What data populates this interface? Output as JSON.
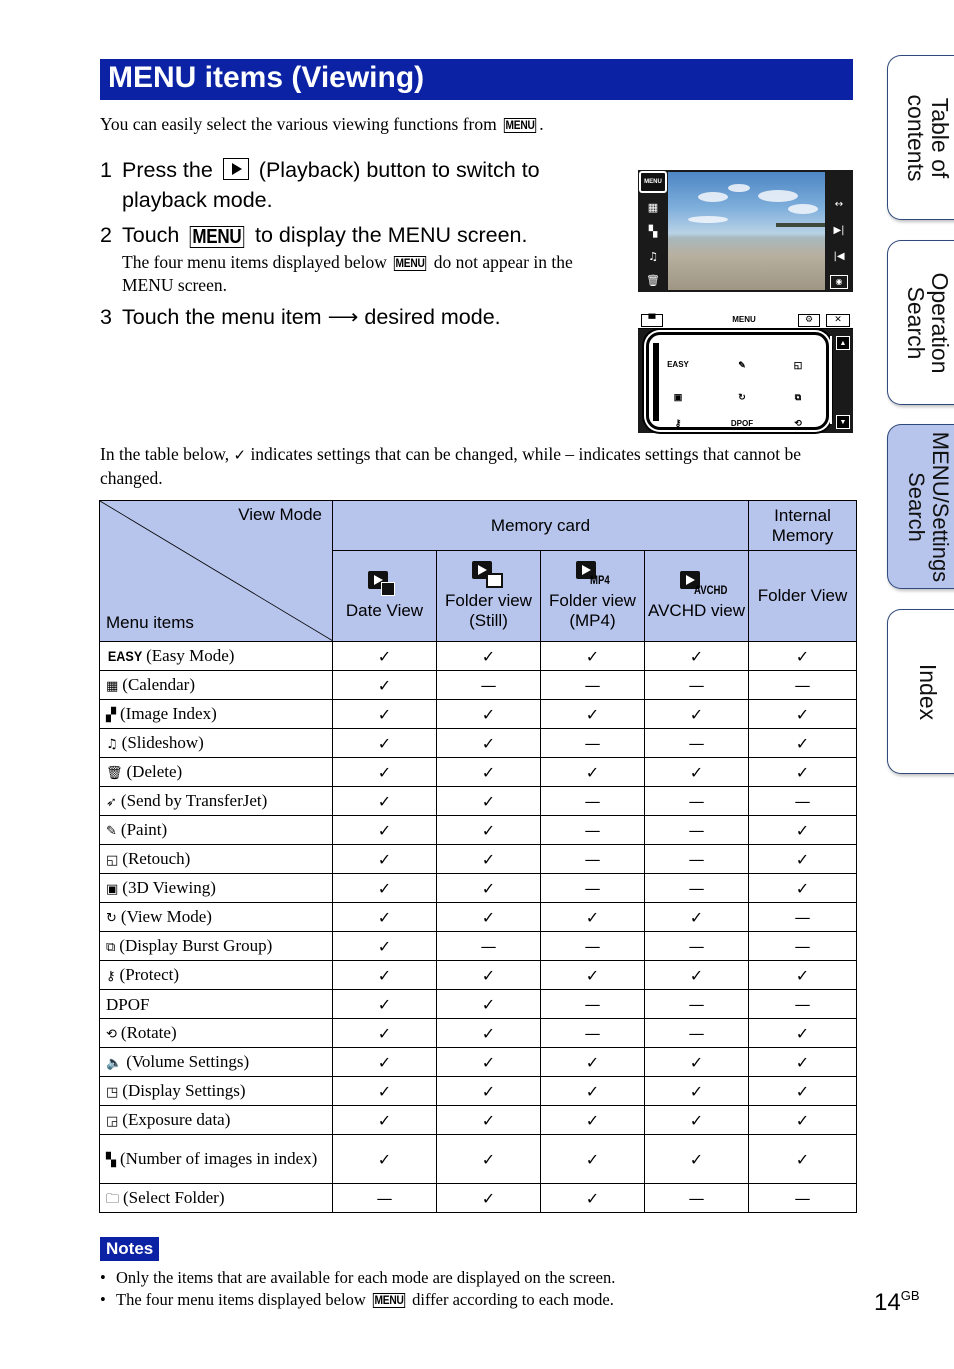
{
  "header": {
    "title": "MENU items (Viewing)"
  },
  "intro": {
    "text": "You can easily select the various viewing functions from",
    "menu_glyph": "MENU",
    "end": "."
  },
  "steps": [
    {
      "num": "1",
      "pre": "Press the",
      "icon": "playback-icon",
      "post": "(Playback) button to switch to playback mode."
    },
    {
      "num": "2",
      "pre": "Touch",
      "glyph": "MENU",
      "post": "to display the MENU screen.",
      "note_pre": "The four menu items displayed below",
      "note_glyph": "MENU",
      "note_post": "do not appear in the MENU screen."
    },
    {
      "num": "3",
      "pre": "Touch the menu item",
      "arrow": "⟶",
      "post": "desired mode."
    }
  ],
  "camera_screen_1": {
    "menu_button": "MENU",
    "left_icons": [
      "calendar-icon",
      "image-index-icon",
      "slideshow-icon",
      "delete-icon"
    ],
    "right_icons": [
      "zoom-arrows-icon",
      "next-icon",
      "previous-icon",
      "camera-icon"
    ]
  },
  "camera_screen_2": {
    "title": "MENU",
    "top_buttons": {
      "left": "toolbox-icon",
      "settings": "gear-icon",
      "close": "✕"
    },
    "items": [
      "EASY",
      "paint-icon",
      "retouch-icon",
      "3d-viewing-icon",
      "view-mode-icon",
      "burst-group-icon",
      "protect-icon",
      "DPOF",
      "rotate-icon"
    ],
    "scroll_up": "▲",
    "scroll_down": "▼"
  },
  "legend": {
    "pre": "In the table below,",
    "check": "✓",
    "post": "indicates settings that can be changed, while – indicates settings that cannot be changed."
  },
  "table": {
    "corner_top": "View Mode",
    "corner_bottom": "Menu items",
    "group_memory_card": "Memory card",
    "group_internal": "Internal Memory",
    "columns": [
      {
        "label": "Date View",
        "icon": "date-view-icon"
      },
      {
        "label": "Folder view (Still)",
        "icon": "folder-view-still-icon"
      },
      {
        "label": "Folder view (MP4)",
        "icon": "folder-view-mp4-icon",
        "sub": "MP4"
      },
      {
        "label": "AVCHD view",
        "icon": "avchd-view-icon",
        "sub": "AVCHD"
      },
      {
        "label": "Folder View",
        "icon": ""
      }
    ],
    "check_symbol": "✓",
    "dash_symbol": "—",
    "rows": [
      {
        "icon": "EASY",
        "label": "(Easy Mode)",
        "values": [
          true,
          true,
          true,
          true,
          true
        ]
      },
      {
        "icon": "▦",
        "label": "(Calendar)",
        "values": [
          true,
          false,
          false,
          false,
          false
        ]
      },
      {
        "icon": "▞",
        "label": "(Image Index)",
        "values": [
          true,
          true,
          true,
          true,
          true
        ]
      },
      {
        "icon": "♫",
        "label": "(Slideshow)",
        "values": [
          true,
          true,
          false,
          false,
          true
        ]
      },
      {
        "icon": "🗑",
        "label": "(Delete)",
        "values": [
          true,
          true,
          true,
          true,
          true
        ]
      },
      {
        "icon": "➶",
        "label": "(Send by TransferJet)",
        "values": [
          true,
          true,
          false,
          false,
          false
        ]
      },
      {
        "icon": "✎",
        "label": "(Paint)",
        "values": [
          true,
          true,
          false,
          false,
          true
        ]
      },
      {
        "icon": "◱",
        "label": "(Retouch)",
        "values": [
          true,
          true,
          false,
          false,
          true
        ]
      },
      {
        "icon": "▣",
        "label": "(3D Viewing)",
        "values": [
          true,
          true,
          false,
          false,
          true
        ]
      },
      {
        "icon": "↻",
        "label": "(View Mode)",
        "values": [
          true,
          true,
          true,
          true,
          false
        ]
      },
      {
        "icon": "⧉",
        "label": "(Display Burst Group)",
        "values": [
          true,
          false,
          false,
          false,
          false
        ]
      },
      {
        "icon": "⚷",
        "label": "(Protect)",
        "values": [
          true,
          true,
          true,
          true,
          true
        ]
      },
      {
        "icon": "",
        "label": "DPOF",
        "values": [
          true,
          true,
          false,
          false,
          false
        ]
      },
      {
        "icon": "⟲",
        "label": "(Rotate)",
        "values": [
          true,
          true,
          false,
          false,
          true
        ]
      },
      {
        "icon": "🔈",
        "label": "(Volume Settings)",
        "values": [
          true,
          true,
          true,
          true,
          true
        ]
      },
      {
        "icon": "◳",
        "label": "(Display Settings)",
        "values": [
          true,
          true,
          true,
          true,
          true
        ]
      },
      {
        "icon": "◲",
        "label": "(Exposure data)",
        "values": [
          true,
          true,
          true,
          true,
          true
        ]
      },
      {
        "icon": "▚",
        "label": "(Number of images in index)",
        "values": [
          true,
          true,
          true,
          true,
          true
        ]
      },
      {
        "icon": "🗀",
        "label": "(Select Folder)",
        "values": [
          false,
          true,
          true,
          false,
          false
        ]
      }
    ]
  },
  "notes": {
    "badge": "Notes",
    "items": [
      {
        "text": "Only the items that are available for each mode are displayed on the screen."
      },
      {
        "pre": "The four menu items displayed below",
        "glyph": "MENU",
        "post": "differ according to each mode."
      }
    ]
  },
  "page": {
    "number": "14",
    "suffix": "GB"
  },
  "side_tabs": [
    {
      "label": "Table of\ncontents",
      "active": false
    },
    {
      "label": "Operation\nSearch",
      "active": false
    },
    {
      "label": "MENU/Settings\nSearch",
      "active": true
    },
    {
      "label": "Index",
      "active": false
    }
  ]
}
